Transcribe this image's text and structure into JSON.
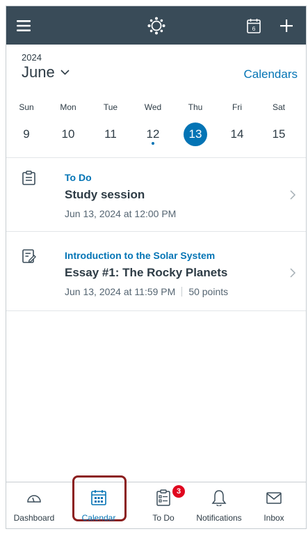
{
  "header": {
    "menu_icon": "hamburger-menu-icon",
    "logo_icon": "canvas-logo-icon",
    "calendar_today_icon": "calendar-today-icon",
    "calendar_today_day": "6",
    "add_icon": "plus-icon"
  },
  "calendar": {
    "year": "2024",
    "month": "June",
    "calendars_link": "Calendars",
    "days": [
      {
        "name": "Sun",
        "num": "9"
      },
      {
        "name": "Mon",
        "num": "10"
      },
      {
        "name": "Tue",
        "num": "11"
      },
      {
        "name": "Wed",
        "num": "12"
      },
      {
        "name": "Thu",
        "num": "13"
      },
      {
        "name": "Fri",
        "num": "14"
      },
      {
        "name": "Sat",
        "num": "15"
      }
    ]
  },
  "events": [
    {
      "icon": "todo-note-icon",
      "context": "To Do",
      "title": "Study session",
      "date": "Jun 13, 2024 at 12:00 PM"
    },
    {
      "icon": "assignment-icon",
      "context": "Introduction to the Solar System",
      "title": "Essay #1: The Rocky Planets",
      "date": "Jun 13, 2024 at 11:59 PM",
      "points": "50 points"
    }
  ],
  "nav": {
    "tabs": [
      {
        "label": "Dashboard",
        "icon": "dashboard-icon"
      },
      {
        "label": "Calendar",
        "icon": "calendar-icon"
      },
      {
        "label": "To Do",
        "icon": "todo-icon",
        "badge": "3"
      },
      {
        "label": "Notifications",
        "icon": "bell-icon"
      },
      {
        "label": "Inbox",
        "icon": "envelope-icon"
      }
    ]
  },
  "colors": {
    "header_bg": "#394b58",
    "accent": "#0374b5",
    "badge": "#e0061f",
    "highlight": "#8b1d1d"
  }
}
